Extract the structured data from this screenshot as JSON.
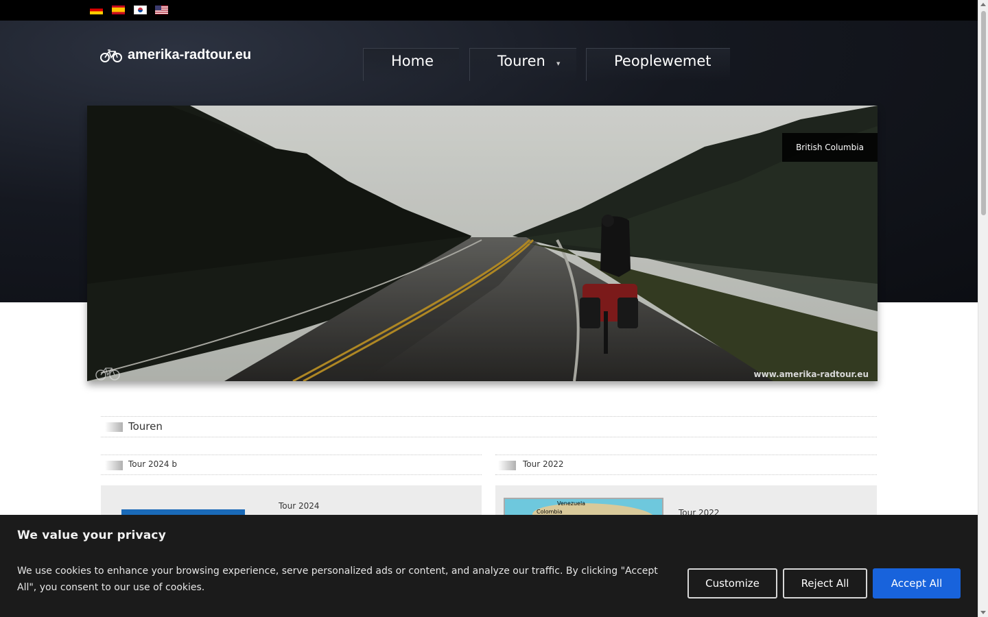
{
  "languages": [
    {
      "icon": "german-flag-icon"
    },
    {
      "icon": "spanish-flag-icon"
    },
    {
      "icon": "korean-flag-icon"
    },
    {
      "icon": "us-flag-icon"
    }
  ],
  "site": {
    "logo_text": "amerika-radtour.eu",
    "logo_icon": "bicycle-icon"
  },
  "nav": {
    "home": "Home",
    "touren": "Touren",
    "people": "Peoplewemet"
  },
  "hero": {
    "caption": "British Columbia",
    "watermark": "www.amerika-radtour.eu"
  },
  "sections": {
    "main_title": "Touren",
    "col_a_title": "Tour 2024 b",
    "col_b_title": "Tour 2022",
    "col_a_card_title": "Tour 2024",
    "col_b_card_title": "Tour 2022",
    "map_labels": [
      "Venezuela",
      "Colombia"
    ]
  },
  "cookie": {
    "title": "We value your privacy",
    "text": "We use cookies to enhance your browsing experience, serve personalized ads or content, and analyze our traffic. By clicking \"Accept All\", you consent to our use of cookies.",
    "customize": "Customize",
    "reject": "Reject All",
    "accept": "Accept All"
  },
  "colors": {
    "accent": "#1863dc",
    "header_bg": "#151820",
    "cookie_bg": "#1b1b1b"
  }
}
